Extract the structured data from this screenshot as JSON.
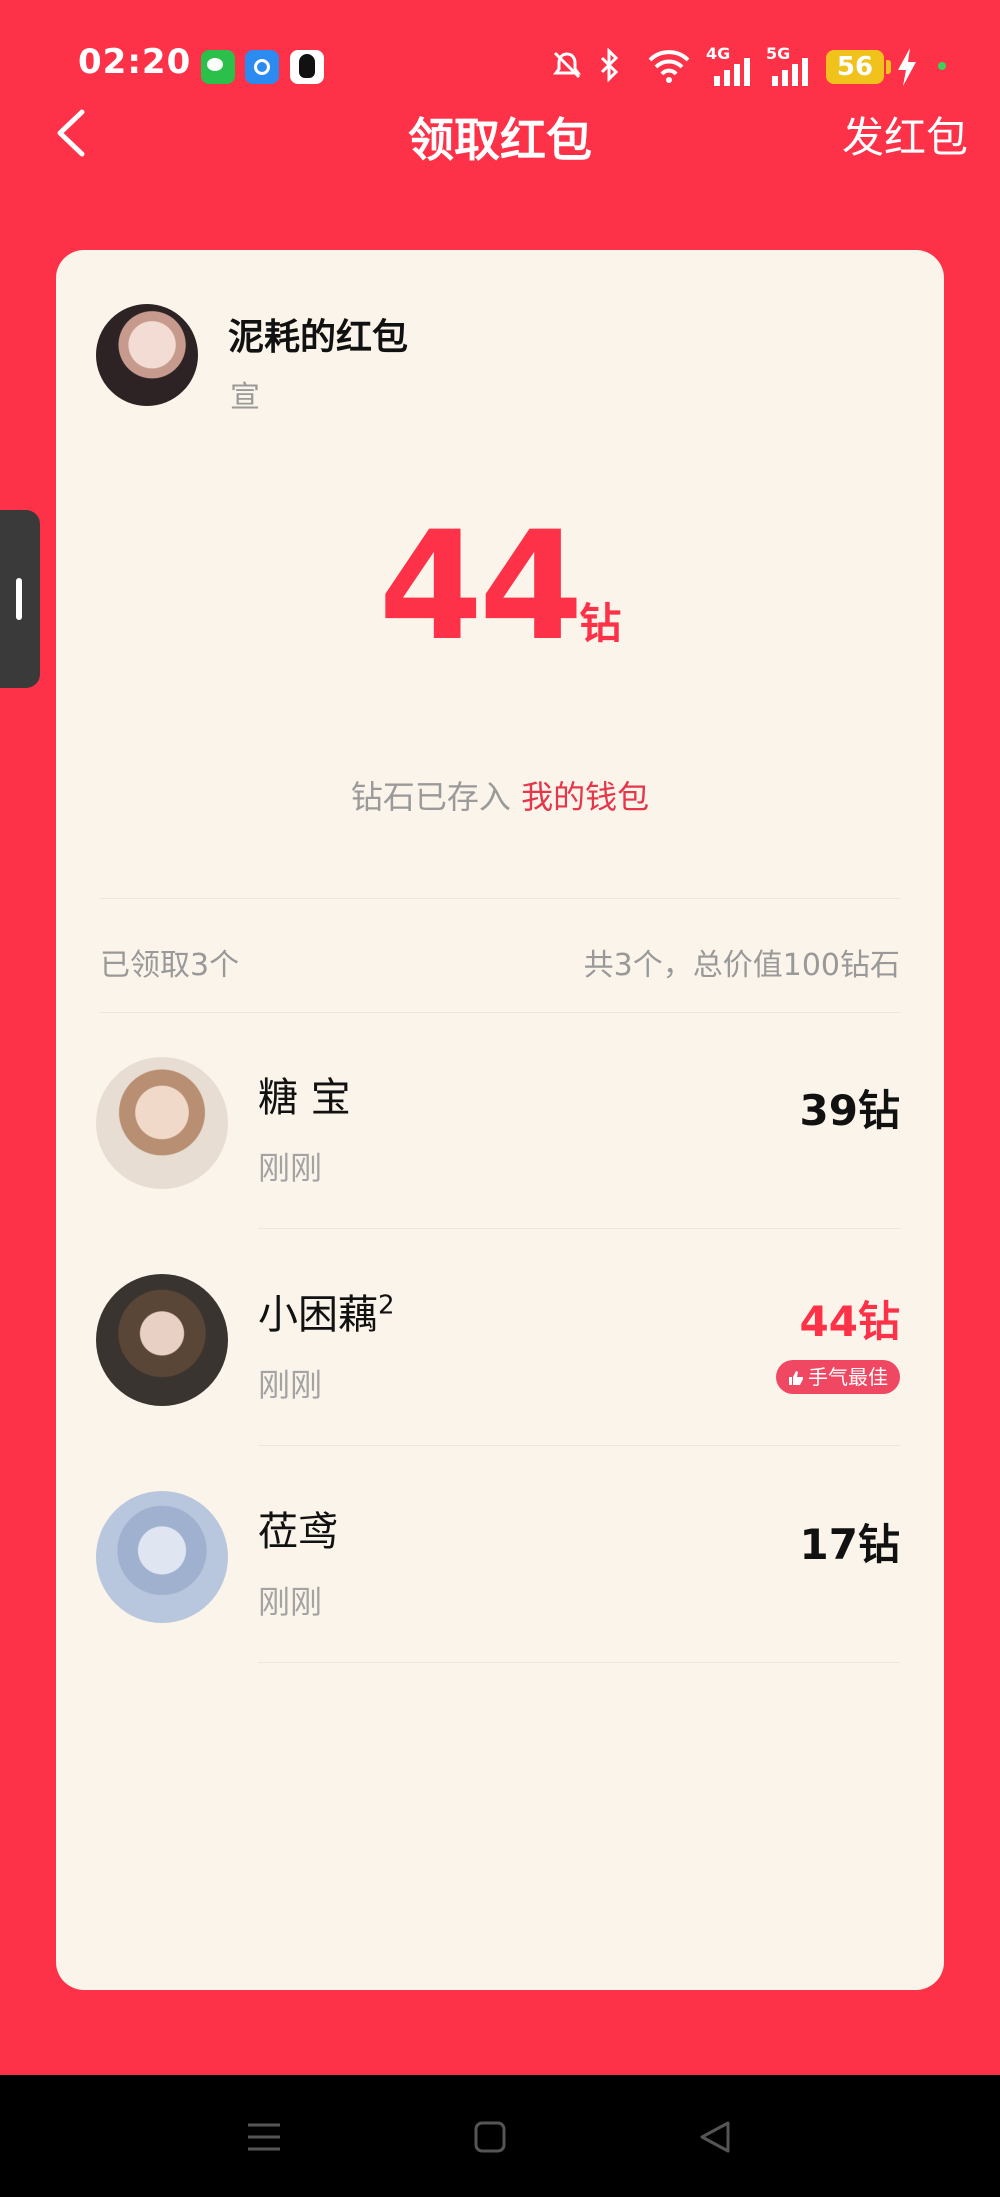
{
  "status_bar": {
    "time": "02:20",
    "apps": [
      "wechat-icon",
      "blue-app-icon",
      "qq-icon"
    ],
    "network_4g": "4G",
    "network_5g": "5G",
    "battery": "56"
  },
  "nav": {
    "title": "领取红包",
    "send_label": "发红包"
  },
  "envelope": {
    "sender_name": "泥耗的红包",
    "sender_sub": "宣",
    "amount": "44",
    "amount_unit": "钻",
    "wallet_note": "钻石已存入",
    "wallet_link": "我的钱包"
  },
  "summary": {
    "claimed": "已领取3个",
    "total": "共3个，总价值100钻石"
  },
  "claims": [
    {
      "name": "糖 宝",
      "time": "刚刚",
      "amount": "39钻"
    },
    {
      "name": "小困藕",
      "name_sup": "2",
      "time": "刚刚",
      "amount": "44钻",
      "badge": "手气最佳"
    },
    {
      "name": "莅鸢",
      "time": "刚刚",
      "amount": "17钻"
    }
  ],
  "colors": {
    "background": "#fd3148",
    "card": "#fbf4ea",
    "accent": "#fd3148",
    "badge": "#f04862"
  }
}
